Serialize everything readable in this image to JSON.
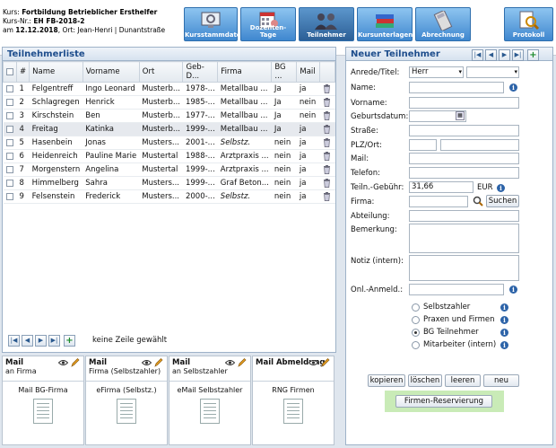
{
  "header": {
    "kurs_label": "Kurs:",
    "kurs_name": "Fortbildung Betrieblicher Ersthelfer",
    "kursnr_label": "Kurs-Nr.:",
    "kursnr": "EH FB-2018-2",
    "am_label": "am",
    "date": "12.12.2018",
    "ort_text": ", Ort: Jean-Henri | Dunantstraße",
    "nav": [
      {
        "label": "Kursstammdaten",
        "icon": "monitor-gear-icon"
      },
      {
        "label": "Dozenten- Tage",
        "icon": "calendar-person-icon"
      },
      {
        "label": "Teilnehmer",
        "icon": "people-icon"
      },
      {
        "label": "Kursunterlagen",
        "icon": "books-icon"
      },
      {
        "label": "Abrechnung",
        "icon": "calculator-icon"
      },
      {
        "label": "Protokoll",
        "icon": "magnifier-document-icon"
      }
    ]
  },
  "list": {
    "title": "Teilnehmerliste",
    "columns": [
      "#",
      "Name",
      "Vorname",
      "Ort",
      "Geb-D...",
      "Firma",
      "BG ...",
      "Mail"
    ],
    "rows": [
      {
        "n": "1",
        "name": "Felgentreff",
        "vorname": "Ingo Leonard",
        "ort": "Musterb...",
        "geb": "1978-...",
        "firma": "Metallbau ...",
        "bg": "Ja",
        "mail": "ja",
        "italic": false
      },
      {
        "n": "2",
        "name": "Schlagregen",
        "vorname": "Henrick",
        "ort": "Musterb...",
        "geb": "1985-...",
        "firma": "Metallbau ...",
        "bg": "Ja",
        "mail": "nein",
        "italic": false
      },
      {
        "n": "3",
        "name": "Kirschstein",
        "vorname": "Ben",
        "ort": "Musterb...",
        "geb": "1977-...",
        "firma": "Metallbau ...",
        "bg": "Ja",
        "mail": "nein",
        "italic": false
      },
      {
        "n": "4",
        "name": "Freitag",
        "vorname": "Katinka",
        "ort": "Musterb...",
        "geb": "1999-...",
        "firma": "Metallbau ...",
        "bg": "Ja",
        "mail": "ja",
        "italic": false
      },
      {
        "n": "5",
        "name": "Hasenbein",
        "vorname": "Jonas",
        "ort": "Musters...",
        "geb": "2001-...",
        "firma": "Selbstz.",
        "bg": "nein",
        "mail": "ja",
        "italic": true
      },
      {
        "n": "6",
        "name": "Heidenreich",
        "vorname": "Pauline Marie",
        "ort": "Mustertal",
        "geb": "1988-...",
        "firma": "Arztpraxis ...",
        "bg": "nein",
        "mail": "ja",
        "italic": false
      },
      {
        "n": "7",
        "name": "Morgenstern",
        "vorname": "Angelina",
        "ort": "Mustertal",
        "geb": "1999-...",
        "firma": "Arztpraxis ...",
        "bg": "nein",
        "mail": "ja",
        "italic": false
      },
      {
        "n": "8",
        "name": "Himmelberg",
        "vorname": "Sahra",
        "ort": "Musters...",
        "geb": "1999-...",
        "firma": "Graf Beton...",
        "bg": "nein",
        "mail": "ja",
        "italic": false
      },
      {
        "n": "9",
        "name": "Felsenstein",
        "vorname": "Frederick",
        "ort": "Musters...",
        "geb": "2000-...",
        "firma": "Selbstz.",
        "bg": "nein",
        "mail": "ja",
        "italic": true
      }
    ],
    "selected_row": 3,
    "status": "keine Zeile gewählt"
  },
  "mail": [
    {
      "title": "Mail",
      "sub": "an Firma",
      "doc": "Mail BG-Firma"
    },
    {
      "title": "Mail",
      "sub": "Firma (Selbstzahler)",
      "doc": "eFirma (Selbstz.)"
    },
    {
      "title": "Mail",
      "sub": "an Selbstzahler",
      "doc": "eMail Selbstzahler"
    },
    {
      "title": "Mail Abmeldung",
      "sub": "",
      "doc": "RNG Firmen"
    }
  ],
  "form": {
    "title": "Neuer Teilnehmer",
    "anrede_label": "Anrede/Titel:",
    "anrede_value": "Herr",
    "name_label": "Name:",
    "vorname_label": "Vorname:",
    "geburtsdatum_label": "Geburtsdatum:",
    "strasse_label": "Straße:",
    "plzort_label": "PLZ/Ort:",
    "mail_label": "Mail:",
    "telefon_label": "Telefon:",
    "gebuehr_label": "Teiln.-Gebühr:",
    "gebuehr_value": "31,66",
    "currency": "EUR",
    "firma_label": "Firma:",
    "suchen": "Suchen",
    "abteilung_label": "Abteilung:",
    "bemerkung_label": "Bemerkung:",
    "notiz_label": "Notiz (intern):",
    "onl_label": "Onl.-Anmeld.:",
    "radios": [
      "Selbstzahler",
      "Praxen und Firmen",
      "BG Teilnehmer",
      "Mitarbeiter (intern)"
    ],
    "radio_selected": 2,
    "buttons": [
      "kopieren",
      "löschen",
      "leeren",
      "neu"
    ],
    "reservierung": "Firmen-Reservierung"
  }
}
